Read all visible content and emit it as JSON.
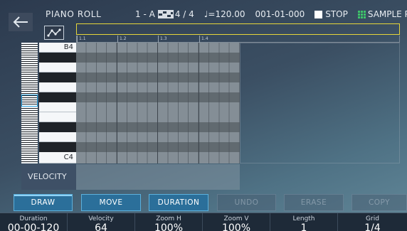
{
  "header": {
    "title": "PIANO ROLL",
    "track": "1 - A",
    "time_signature": "4 / 4",
    "tempo": "♩=120.00",
    "position": "001-01-000",
    "transport_state": "STOP",
    "sample_pad_label": "SAMPLE PAD"
  },
  "icons": {
    "back": "left-arrow-icon",
    "curve": "curve-icon",
    "pattern": "pattern-icon",
    "stop": "stop-icon",
    "sample_pad": "grid-pad-icon"
  },
  "ruler": {
    "marks": [
      "1.1",
      "1.2",
      "1.3",
      "1.4"
    ]
  },
  "piano": {
    "top_note": "B4",
    "bottom_note": "C4"
  },
  "velocity": {
    "label": "VELOCITY"
  },
  "tools": [
    {
      "label": "DRAW",
      "enabled": true,
      "selected": true
    },
    {
      "label": "MOVE",
      "enabled": true,
      "selected": false
    },
    {
      "label": "DURATION",
      "enabled": true,
      "selected": false
    },
    {
      "label": "UNDO",
      "enabled": false,
      "selected": false
    },
    {
      "label": "ERASE",
      "enabled": false,
      "selected": false
    },
    {
      "label": "COPY",
      "enabled": false,
      "selected": false
    }
  ],
  "params": [
    {
      "label": "Duration",
      "value": "00-00-120"
    },
    {
      "label": "Velocity",
      "value": "64"
    },
    {
      "label": "Zoom H",
      "value": "100%"
    },
    {
      "label": "Zoom V",
      "value": "100%"
    },
    {
      "label": "Length",
      "value": "1"
    },
    {
      "label": "Grid",
      "value": "1/4"
    }
  ],
  "colors": {
    "accent": "#2aa3e0",
    "button_fill": "#2b6f9a",
    "timeline_highlight": "#e6d63a",
    "sample_pad_icon": "#3ec46a"
  }
}
